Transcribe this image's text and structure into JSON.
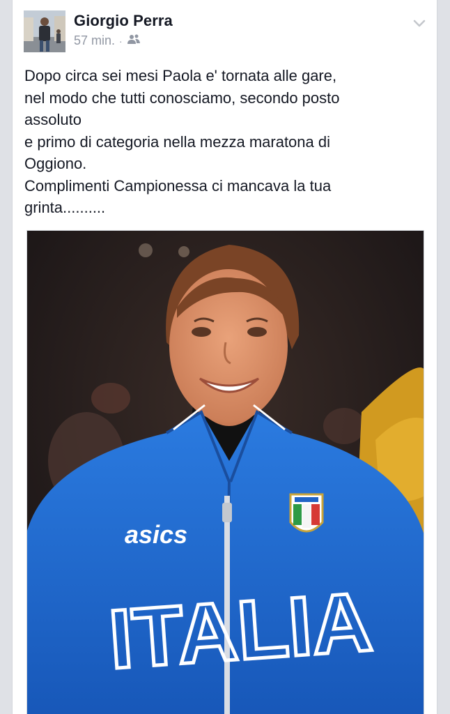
{
  "post": {
    "author": "Giorgio Perra",
    "time": "57 min.",
    "separator": "·",
    "audience_icon": "friends-icon",
    "menu_icon": "chevron-down-icon",
    "text_lines": [
      "Dopo circa sei mesi Paola e' tornata alle gare,",
      "nel modo che tutti conosciamo, secondo posto",
      "assoluto",
      "e primo di categoria nella mezza maratona di",
      "Oggiono.",
      "Complimenti Campionessa ci mancava la tua",
      "grinta.........."
    ],
    "photo": {
      "jacket_brand": "asics",
      "jacket_text": "ITALIA"
    }
  },
  "colors": {
    "author": "#141823",
    "meta": "#9197a3",
    "jacket": "#1f63c6",
    "background": "#dfe1e6"
  }
}
